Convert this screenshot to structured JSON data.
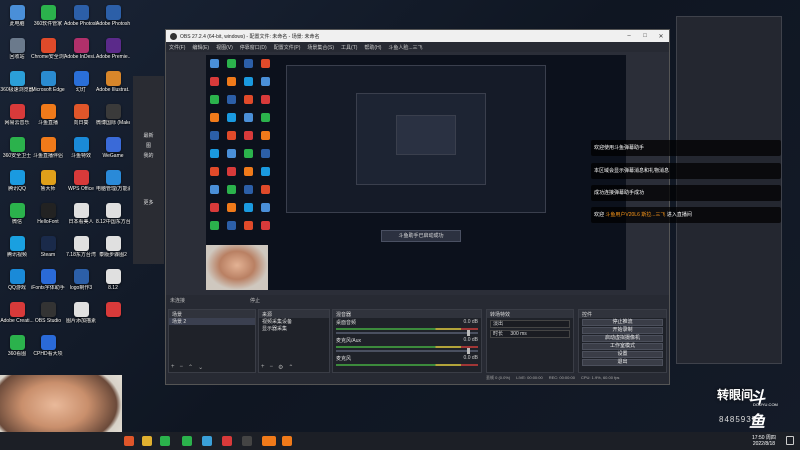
{
  "desktop": {
    "icons": [
      {
        "label": "此电脑",
        "color": "#4a8fd8"
      },
      {
        "label": "360软件管家",
        "color": "#2bb24c"
      },
      {
        "label": "Adobe Photosh...",
        "color": "#2c5fa8"
      },
      {
        "label": "Adobe Photosh...",
        "color": "#2c5fa8"
      },
      {
        "label": "回收站",
        "color": "#6b7a8c"
      },
      {
        "label": "Chrome安全浏览器",
        "color": "#e04a2a"
      },
      {
        "label": "Adobe InDesi...",
        "color": "#b0306a"
      },
      {
        "label": "Adobe Premie...",
        "color": "#5b2a8a"
      },
      {
        "label": "360极速浏览器",
        "color": "#2b9fd8"
      },
      {
        "label": "Microsoft Edge",
        "color": "#2a8bd0"
      },
      {
        "label": "幻灯",
        "color": "#2a6fd8"
      },
      {
        "label": "Adobe Illustrat...",
        "color": "#d8862a"
      },
      {
        "label": "网易云音乐",
        "color": "#d83a3a"
      },
      {
        "label": "斗鱼直播",
        "color": "#f07a1a"
      },
      {
        "label": "向日葵",
        "color": "#e0562a"
      },
      {
        "label": "微博国际 (Makeup...",
        "color": "#3a3a3a"
      },
      {
        "label": "360安全卫士",
        "color": "#2bb24c"
      },
      {
        "label": "斗鱼直播伴侣",
        "color": "#f07a1a"
      },
      {
        "label": "斗鱼特效",
        "color": "#1a8ad8"
      },
      {
        "label": "WeGame",
        "color": "#3a6ad8"
      },
      {
        "label": "腾讯QQ",
        "color": "#1a9ae0"
      },
      {
        "label": "鲁大师",
        "color": "#e0a01a"
      },
      {
        "label": "WPS Office",
        "color": "#d83a3a"
      },
      {
        "label": "电脑管理(万能驱...",
        "color": "#2a8ad8"
      },
      {
        "label": "微信",
        "color": "#2bb24c"
      },
      {
        "label": "HelloFont",
        "color": "#222"
      },
      {
        "label": "日本看美人",
        "color": "#e0e0e0"
      },
      {
        "label": "8.12中国东方台湾直播...",
        "color": "#e0e0e0"
      },
      {
        "label": "腾讯视频",
        "color": "#1aa0e0"
      },
      {
        "label": "Steam",
        "color": "#1a2a4a"
      },
      {
        "label": "7.18东方台湾",
        "color": "#e0e0e0"
      },
      {
        "label": "泰版步骤图2",
        "color": "#e0e0e0"
      },
      {
        "label": "QQ游戏",
        "color": "#1a8ad8"
      },
      {
        "label": "iFonts字体助手",
        "color": "#2a6ad8"
      },
      {
        "label": "logo制作3",
        "color": "#2c5fa8"
      },
      {
        "label": "8.12",
        "color": "#e0e0e0"
      },
      {
        "label": "Adobe Creati...",
        "color": "#d83a3a"
      },
      {
        "label": "OBS Studio",
        "color": "#333"
      },
      {
        "label": "图片添加描素",
        "color": "#e0e0e0"
      },
      {
        "label": "",
        "color": "#d83a3a"
      },
      {
        "label": "360看图",
        "color": "#2bb24c"
      },
      {
        "label": "CPHD看大项",
        "color": "#2a6ad8"
      }
    ]
  },
  "obs": {
    "title": "OBS 27.2.4 (64-bit, windows) - 配置文件: 未命名 - 场景: 未命名",
    "menu": [
      "文件(F)",
      "编辑(E)",
      "视图(V)",
      "停靠窗口(D)",
      "配置文件(P)",
      "场景集合(S)",
      "工具(T)",
      "帮助(H)",
      "斗鱼人脸...三飞"
    ],
    "preview_toast": "斗鱼助手已启动成功",
    "status_left": "未连接",
    "status_right": "停止",
    "docks": {
      "scenes": {
        "title": "场景",
        "items": [
          "场景 2"
        ]
      },
      "sources": {
        "title": "来源",
        "items": [
          "视频采集设备",
          "显示器采集"
        ]
      },
      "mixer": {
        "title": "混音器",
        "tracks": [
          {
            "name": "桌面音频",
            "db": "0.0 dB"
          },
          {
            "name": "麦克风/Aux",
            "db": "0.0 dB"
          },
          {
            "name": "麦克风",
            "db": "0.0 dB"
          }
        ]
      },
      "transitions": {
        "title": "转场特效",
        "mode": "淡出",
        "duration_label": "时长",
        "duration": "300 ms"
      },
      "controls": {
        "title": "控件",
        "buttons": [
          "停止推流",
          "开始录制",
          "启动虚拟摄像机",
          "工作室模式",
          "设置",
          "退出"
        ]
      }
    },
    "statusbar": [
      "丢帧 0 (0.0%)",
      "LIVE: 00:00:00",
      "REC: 00:00:00",
      "CPU: 1.9%, 60.00 fps"
    ]
  },
  "left_panel": {
    "menu": [
      "最新",
      "图",
      "我的",
      "更多"
    ]
  },
  "notifications": [
    {
      "text": "欢迎使用斗鱼弹幕助手",
      "highlight": ""
    },
    {
      "text": "本区域会显示弹幕消息和礼物消息",
      "highlight": ""
    },
    {
      "text": "成功连接弹幕助手成功",
      "highlight": ""
    },
    {
      "text": "欢迎",
      "highlight": "斗鱼用户V20L6 斯拉...三飞",
      "suffix": "进入直播间"
    }
  ],
  "watermark": {
    "cn": "转眼间",
    "logo": "斗鱼",
    "url": "DOUYU.COM",
    "room_id": "8485935"
  },
  "taskbar": {
    "time": "17:50 周四",
    "date": "2022/8/18"
  }
}
